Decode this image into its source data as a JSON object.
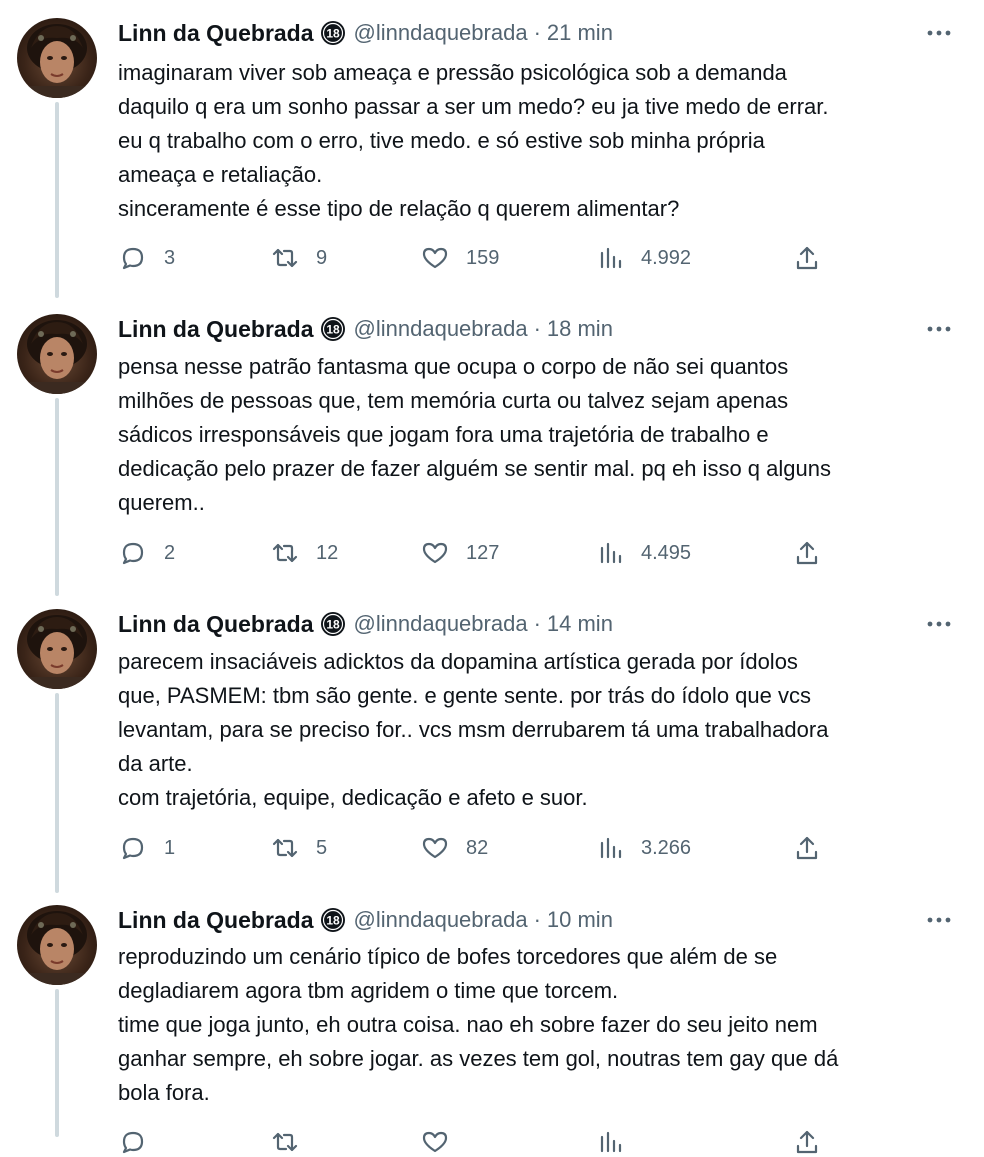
{
  "colors": {
    "text": "#0f1419",
    "secondary": "#536471",
    "thread_line": "#cfd9de",
    "badge": "#0f1419"
  },
  "tweets": [
    {
      "author": {
        "name": "Linn da Quebrada",
        "handle": "@linndaquebrada",
        "badge": "18"
      },
      "separator": "·",
      "time": "21 min",
      "lines": [
        "imaginaram viver sob ameaça e pressão psicológica sob a demanda",
        "daquilo q era um sonho passar a ser um medo? eu ja tive medo de errar.",
        "eu q trabalho com o erro, tive medo. e só estive sob minha própria",
        "ameaça e retaliação.",
        "sinceramente é esse tipo de relação q querem alimentar?"
      ],
      "stats": {
        "replies": "3",
        "retweets": "9",
        "likes": "159",
        "views": "4.992"
      }
    },
    {
      "author": {
        "name": "Linn da Quebrada",
        "handle": "@linndaquebrada",
        "badge": "18"
      },
      "separator": "·",
      "time": "18 min",
      "lines": [
        "pensa nesse patrão fantasma que ocupa o corpo de não sei quantos",
        "milhões de pessoas que, tem memória curta ou talvez sejam apenas",
        "sádicos irresponsáveis que jogam fora uma trajetória de trabalho e",
        "dedicação pelo prazer de fazer alguém se sentir mal. pq eh isso q alguns",
        "querem.."
      ],
      "stats": {
        "replies": "2",
        "retweets": "12",
        "likes": "127",
        "views": "4.495"
      }
    },
    {
      "author": {
        "name": "Linn da Quebrada",
        "handle": "@linndaquebrada",
        "badge": "18"
      },
      "separator": "·",
      "time": "14 min",
      "lines": [
        "parecem insaciáveis adicktos da dopamina artística gerada por ídolos",
        "que, PASMEM: tbm são gente. e gente sente. por trás do ídolo que vcs",
        "levantam, para se preciso for.. vcs msm derrubarem tá uma trabalhadora",
        "da arte.",
        "com trajetória, equipe, dedicação e afeto e suor."
      ],
      "stats": {
        "replies": "1",
        "retweets": "5",
        "likes": "82",
        "views": "3.266"
      }
    },
    {
      "author": {
        "name": "Linn da Quebrada",
        "handle": "@linndaquebrada",
        "badge": "18"
      },
      "separator": "·",
      "time": "10 min",
      "lines": [
        "reproduzindo um cenário típico de bofes torcedores que além de se",
        "degladiarem agora tbm agridem o time que torcem.",
        "time que joga junto, eh outra coisa. nao eh sobre fazer do seu jeito nem",
        "ganhar sempre, eh sobre jogar. as vezes tem gol, noutras tem gay que dá",
        "bola fora."
      ],
      "stats": {
        "replies": "",
        "retweets": "",
        "likes": "",
        "views": ""
      }
    }
  ]
}
